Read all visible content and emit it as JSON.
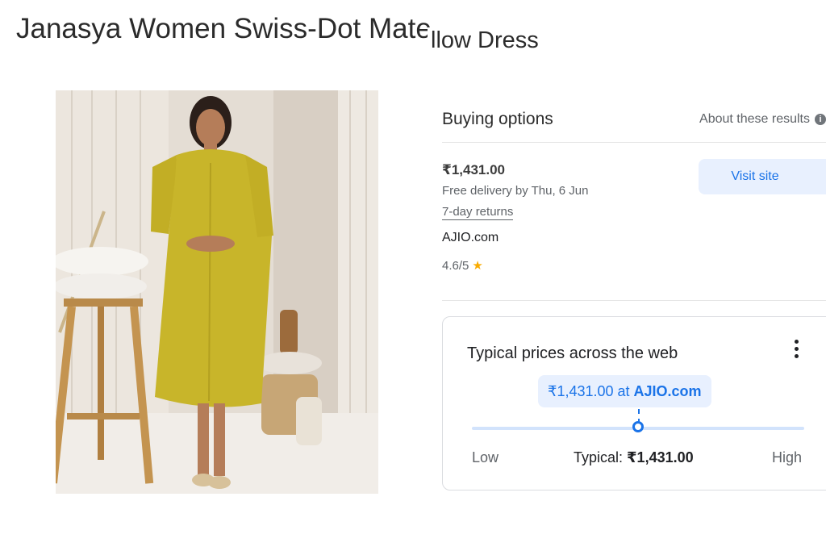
{
  "product": {
    "title_part1": "Janasya Women Swiss-Dot Mate",
    "title_part2": "llow Dress"
  },
  "buying_options": {
    "title": "Buying options",
    "about_label": "About these results",
    "about_icon": "info-icon",
    "offer": {
      "price": "₹1,431.00",
      "delivery": "Free delivery by Thu, 6 Jun",
      "returns": "7-day returns",
      "store": "AJIO.com",
      "rating": "4.6/5",
      "rating_icon": "star-icon",
      "visit_label": "Visit site"
    }
  },
  "typical_prices": {
    "title": "Typical prices across the web",
    "menu_icon": "more-vert-icon",
    "bubble_price": "₹1,431.00 at ",
    "bubble_store": "AJIO.com",
    "marker_fraction": 0.5,
    "low_label": "Low",
    "typical_label": "Typical: ",
    "typical_value": "₹1,431.00",
    "high_label": "High"
  },
  "colors": {
    "accent": "#1a73e8",
    "accent_bg": "#e8f0fe",
    "dress": "#c8b52a",
    "star": "#f9ab00"
  }
}
